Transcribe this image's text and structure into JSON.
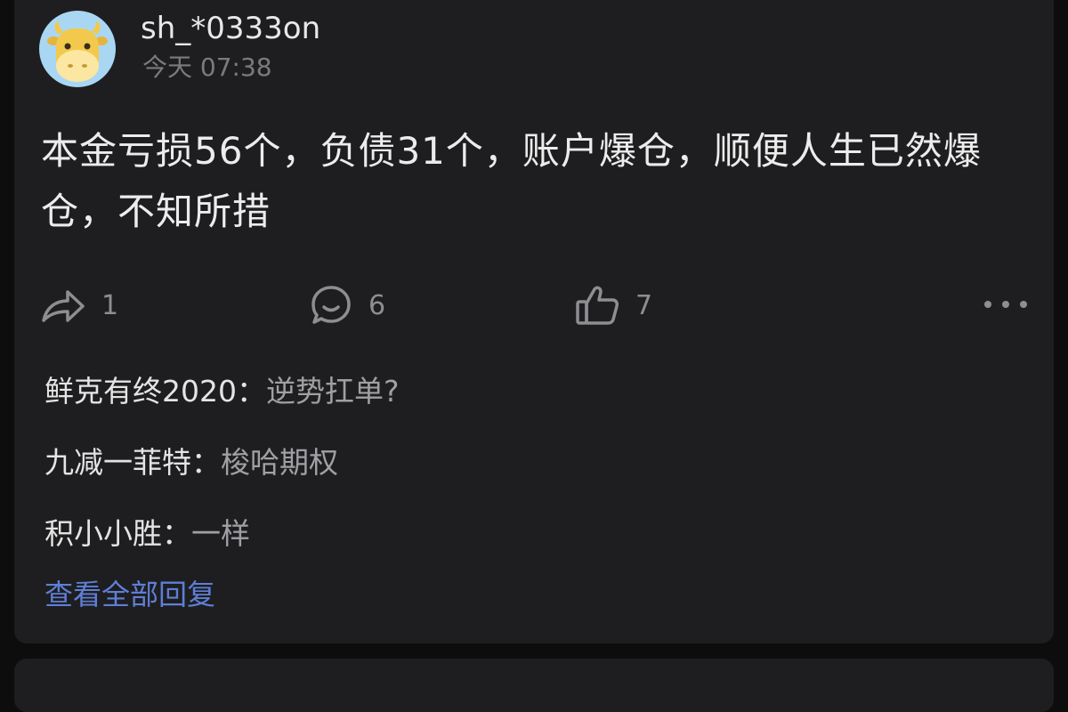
{
  "post": {
    "username": "sh_*0333on",
    "time": "今天 07:38",
    "text": "本金亏损56个，负债31个，账户爆仓，顺便人生已然爆仓，不知所措",
    "actions": {
      "share_count": "1",
      "comment_count": "6",
      "like_count": "7"
    }
  },
  "replies": [
    {
      "author": "鲜克有终2020：",
      "content": "逆势扛单?"
    },
    {
      "author": "九减一菲特：",
      "content": "梭哈期权"
    },
    {
      "author": "积小小胜：",
      "content": "一样"
    }
  ],
  "view_all_label": "查看全部回复",
  "icons": {
    "avatar": "cow-avatar-icon",
    "share": "share-arrow-icon",
    "comment": "comment-bubble-icon",
    "like": "thumbs-up-icon",
    "more": "more-dots-icon"
  },
  "colors": {
    "background": "#1e1e20",
    "link": "#5f7fd6",
    "avatar_bg": "#a9d7f3"
  }
}
